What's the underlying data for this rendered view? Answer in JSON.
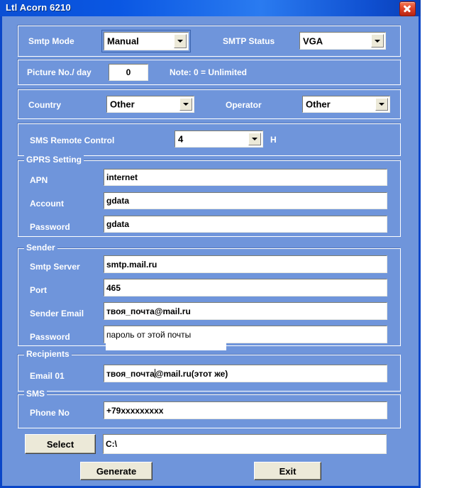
{
  "window": {
    "title": "Ltl Acorn 6210",
    "close_icon": "close-icon",
    "background_color": "#6f95db",
    "titlebar_color": "#0a57e3",
    "close_button_color": "#cc3322"
  },
  "smtp_mode_group": {
    "mode_label": "Smtp Mode",
    "mode_value": "Manual",
    "status_label": "SMTP Status",
    "status_value": "VGA"
  },
  "picture_group": {
    "label": "Picture No./ day",
    "value": "0",
    "note": "Note: 0 = Unlimited"
  },
  "country_group": {
    "country_label": "Country",
    "country_value": "Other",
    "operator_label": "Operator",
    "operator_value": "Other"
  },
  "sms_remote_group": {
    "label": "SMS Remote Control",
    "value": "4",
    "unit": "H"
  },
  "gprs_group": {
    "legend": "GPRS Setting",
    "fields": [
      {
        "label": "APN",
        "value": "internet"
      },
      {
        "label": "Account",
        "value": "gdata"
      },
      {
        "label": "Password",
        "value": "gdata"
      }
    ]
  },
  "sender_group": {
    "legend": "Sender",
    "fields": [
      {
        "label": "Smtp Server",
        "value": "smtp.mail.ru"
      },
      {
        "label": "Port",
        "value": "465"
      },
      {
        "label": "Sender Email",
        "value": "твоя_почта@mail.ru"
      },
      {
        "label": "Password",
        "value": "пароль от этой почты"
      }
    ]
  },
  "recipients_group": {
    "legend": "Recipients",
    "email_label": "Email 01",
    "email_value_before_caret": "твоя_почта",
    "email_value_after_caret": "@mail.ru(этот же)",
    "email_value": "твоя_почта@mail.ru(этот же)"
  },
  "sms_group": {
    "legend": "SMS",
    "phone_label": "Phone No",
    "phone_value": "+79xxxxxxxxx"
  },
  "path_row": {
    "select_label": "Select",
    "path_value": "C:\\"
  },
  "actions": {
    "generate_label": "Generate",
    "exit_label": "Exit"
  }
}
